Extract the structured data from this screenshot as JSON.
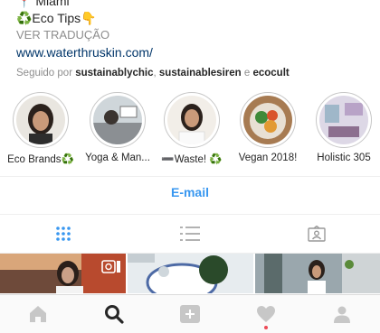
{
  "profile": {
    "location": "📍 Miami",
    "tagline": "♻️Eco Tips👇",
    "translate": "VER TRADUÇÃO",
    "website": "www.waterthruskin.com/",
    "followed_prefix": "Seguido por ",
    "followed_by": [
      "sustainablychic",
      "sustainablesiren",
      "ecocult"
    ],
    "followed_sep": ", ",
    "followed_and": " e "
  },
  "highlights": [
    {
      "label": "Eco Brands♻️",
      "icon": "woman-portrait"
    },
    {
      "label": "Yoga & Man...",
      "icon": "yoga-photo"
    },
    {
      "label": "➖Waste! ♻️",
      "icon": "woman-portrait"
    },
    {
      "label": "Vegan 2018!",
      "icon": "food-bowl"
    },
    {
      "label": "Holistic 305",
      "icon": "room-photo"
    }
  ],
  "contact": {
    "email_label": "E-mail"
  },
  "tabs": [
    {
      "name": "grid",
      "icon": "grid-icon",
      "active": true
    },
    {
      "name": "list",
      "icon": "list-icon",
      "active": false
    },
    {
      "name": "tagged",
      "icon": "tagged-icon",
      "active": false
    }
  ],
  "bottom_nav": [
    {
      "name": "home",
      "icon": "home-icon"
    },
    {
      "name": "search",
      "icon": "search-icon",
      "active": true
    },
    {
      "name": "new-post",
      "icon": "plus-icon"
    },
    {
      "name": "activity",
      "icon": "heart-icon",
      "notification": true
    },
    {
      "name": "profile",
      "icon": "person-icon"
    }
  ],
  "colors": {
    "link": "#003569",
    "accent": "#3897f0",
    "notification": "#ed4956"
  }
}
